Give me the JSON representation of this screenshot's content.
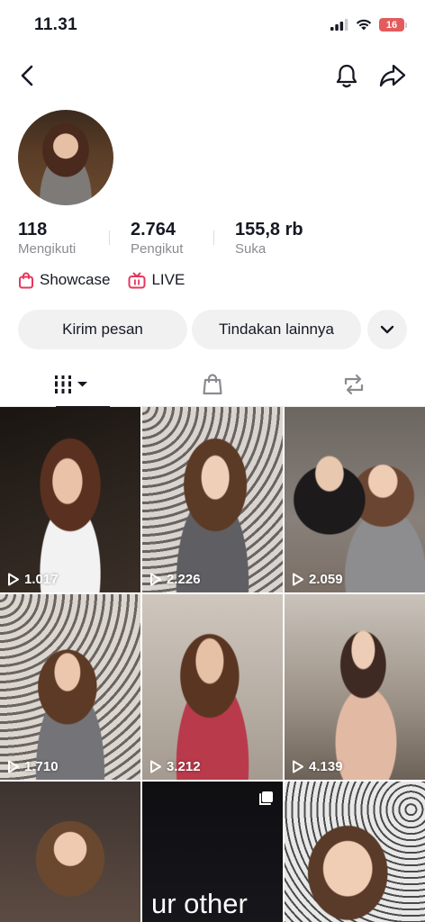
{
  "status_bar": {
    "time": "11.31",
    "battery": "16",
    "battery_color": "#e35b5b"
  },
  "nav": {
    "back_icon": "chevron-left-icon",
    "bell_icon": "bell-icon",
    "share_icon": "share-arrow-icon"
  },
  "profile": {
    "stats": [
      {
        "value": "118",
        "label": "Mengikuti"
      },
      {
        "value": "2.764",
        "label": "Pengikut"
      },
      {
        "value": "155,8 rb",
        "label": "Suka"
      }
    ],
    "links": {
      "showcase": "Showcase",
      "live": "LIVE"
    },
    "accent_color": "#e6375b"
  },
  "actions": {
    "message": "Kirim pesan",
    "more": "Tindakan lainnya"
  },
  "tabs": [
    {
      "icon": "grid-icon",
      "active": true
    },
    {
      "icon": "shopping-bag-icon",
      "active": false
    },
    {
      "icon": "repost-icon",
      "active": false
    }
  ],
  "videos": [
    {
      "views": "1.017"
    },
    {
      "views": "2.226"
    },
    {
      "views": "2.059"
    },
    {
      "views": "1.710"
    },
    {
      "views": "3.212"
    },
    {
      "views": "4.139"
    },
    {
      "views": ""
    },
    {
      "views": "",
      "overlay_text": "ur other"
    },
    {
      "views": ""
    }
  ]
}
